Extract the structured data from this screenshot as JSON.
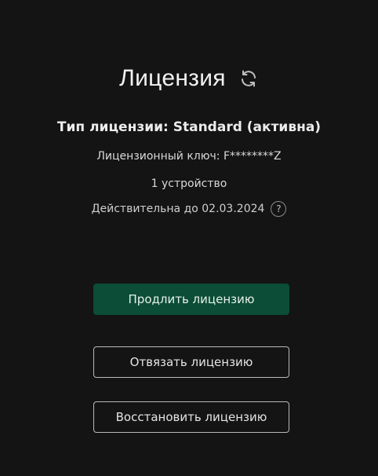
{
  "header": {
    "title": "Лицензия",
    "refresh_icon": "refresh-icon"
  },
  "license": {
    "type_label": "Тип лицензии: Standard (активна)",
    "key_label": "Лицензионный ключ: F********Z",
    "devices_label": "1 устройство",
    "valid_until_label": "Действительна до 02.03.2024",
    "help_glyph": "?"
  },
  "actions": {
    "extend_label": "Продлить лицензию",
    "unlink_label": "Отвязать лицензию",
    "restore_label": "Восстановить лицензию"
  },
  "colors": {
    "background": "#141414",
    "primary_button": "#0b4d36",
    "outline_border": "#b9b9b9"
  }
}
